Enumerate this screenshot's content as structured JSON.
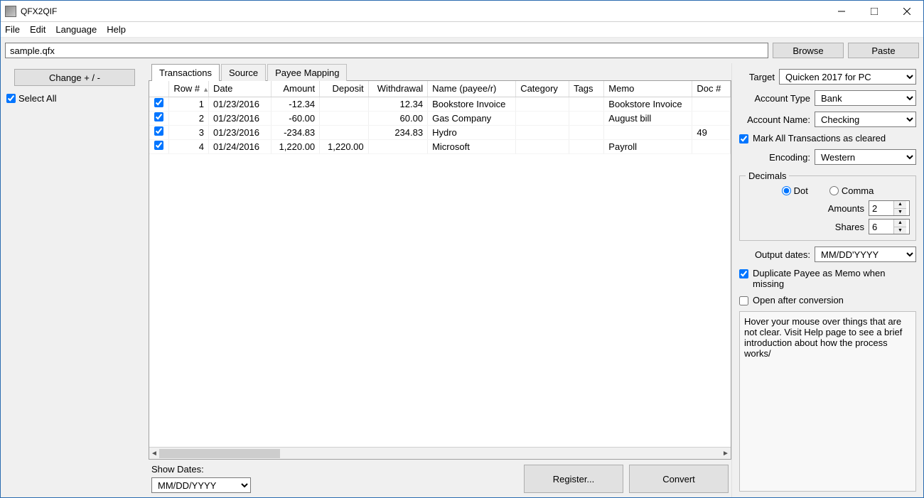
{
  "window": {
    "title": "QFX2QIF"
  },
  "menu": {
    "file": "File",
    "edit": "Edit",
    "language": "Language",
    "help": "Help"
  },
  "filebar": {
    "path": "sample.qfx",
    "browse": "Browse",
    "paste": "Paste"
  },
  "left": {
    "change_btn": "Change + / -",
    "select_all": "Select All"
  },
  "tabs": {
    "transactions": "Transactions",
    "source": "Source",
    "payee_mapping": "Payee Mapping"
  },
  "grid": {
    "headers": {
      "row": "Row #",
      "date": "Date",
      "amount": "Amount",
      "deposit": "Deposit",
      "withdrawal": "Withdrawal",
      "name": "Name (payee/r)",
      "category": "Category",
      "tags": "Tags",
      "memo": "Memo",
      "doc": "Doc #"
    },
    "rows": [
      {
        "checked": true,
        "row": "1",
        "date": "01/23/2016",
        "amount": "-12.34",
        "deposit": "",
        "withdrawal": "12.34",
        "name": "Bookstore Invoice",
        "category": "",
        "tags": "",
        "memo": "Bookstore Invoice",
        "doc": ""
      },
      {
        "checked": true,
        "row": "2",
        "date": "01/23/2016",
        "amount": "-60.00",
        "deposit": "",
        "withdrawal": "60.00",
        "name": "Gas Company",
        "category": "",
        "tags": "",
        "memo": "August bill",
        "doc": ""
      },
      {
        "checked": true,
        "row": "3",
        "date": "01/23/2016",
        "amount": "-234.83",
        "deposit": "",
        "withdrawal": "234.83",
        "name": "Hydro",
        "category": "",
        "tags": "",
        "memo": "",
        "doc": "49"
      },
      {
        "checked": true,
        "row": "4",
        "date": "01/24/2016",
        "amount": "1,220.00",
        "deposit": "1,220.00",
        "withdrawal": "",
        "name": "Microsoft",
        "category": "",
        "tags": "",
        "memo": "Payroll",
        "doc": ""
      }
    ]
  },
  "bottom": {
    "show_dates_label": "Show Dates:",
    "show_dates_value": "MM/DD/YYYY",
    "register": "Register...",
    "convert": "Convert"
  },
  "right": {
    "target_label": "Target",
    "target_value": "Quicken 2017 for PC",
    "account_type_label": "Account Type",
    "account_type_value": "Bank",
    "account_name_label": "Account Name:",
    "account_name_value": "Checking",
    "mark_cleared": "Mark All Transactions as cleared",
    "encoding_label": "Encoding:",
    "encoding_value": "Western",
    "decimals_legend": "Decimals",
    "dot": "Dot",
    "comma": "Comma",
    "amounts_label": "Amounts",
    "amounts_value": "2",
    "shares_label": "Shares",
    "shares_value": "6",
    "output_dates_label": "Output dates:",
    "output_dates_value": "MM/DD'YYYY",
    "dup_payee": "Duplicate Payee as Memo when missing",
    "open_after": "Open after conversion",
    "help_text": "Hover your mouse over things that are not clear. Visit Help page to see a brief introduction about how the process works/"
  }
}
